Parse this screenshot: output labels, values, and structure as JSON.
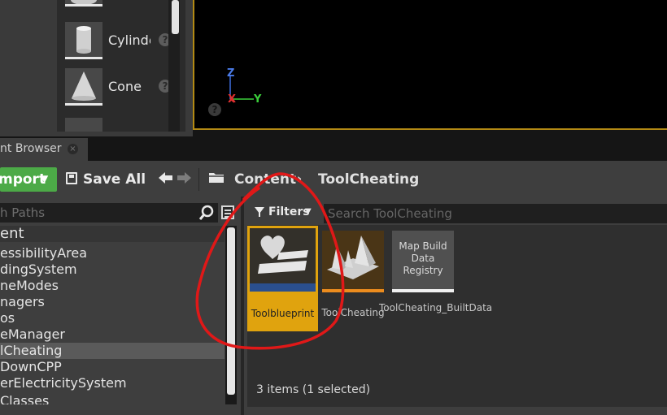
{
  "place_actors": {
    "items": [
      {
        "label": "Cylinder",
        "icon": "cylinder-icon"
      },
      {
        "label": "Cone",
        "icon": "cone-icon"
      }
    ],
    "help_glyph": "?"
  },
  "viewport": {
    "axis_z": "Z",
    "axis_x": "X",
    "axis_y": "Y",
    "help_glyph": "?"
  },
  "tab": {
    "label": "nt Browser",
    "close_glyph": "×"
  },
  "toolbar": {
    "import_label": "mport",
    "import_caret": "▼",
    "save_all_label": "Save All",
    "back_glyph": "🡄",
    "forward_glyph": "🡆"
  },
  "breadcrumb": {
    "root": "Content",
    "separator": "›",
    "current": "ToolCheating"
  },
  "sources": {
    "search_placeholder": "h Paths",
    "tree": [
      {
        "label": "ent",
        "selected": false,
        "root": true
      },
      {
        "label": "essibilityArea",
        "selected": false
      },
      {
        "label": "dingSystem",
        "selected": false
      },
      {
        "label": "neModes",
        "selected": false
      },
      {
        "label": "nagers",
        "selected": false
      },
      {
        "label": "os",
        "selected": false
      },
      {
        "label": "eManager",
        "selected": false
      },
      {
        "label": "lCheating",
        "selected": true
      },
      {
        "label": "DownCPP",
        "selected": false
      },
      {
        "label": "erElectricitySystem",
        "selected": false
      },
      {
        "label": "Classes",
        "selected": false
      }
    ]
  },
  "assets": {
    "filters_label": "Filters",
    "filters_caret": "▼",
    "search_placeholder": "Search ToolCheating",
    "items": [
      {
        "label": "Toolblueprint",
        "selected": true,
        "accent": "#e0a30e"
      },
      {
        "label": "ToolCheating",
        "selected": false,
        "accent": "#ec8c1e"
      },
      {
        "label": "ToolCheating_BuiltData",
        "thumb_text": "Map Build Data Registry",
        "selected": false,
        "accent": "#f0f0f0"
      }
    ],
    "status": "3 items (1 selected)"
  },
  "colors": {
    "accent_green": "#4caa47",
    "selection_yellow": "#e0a30e",
    "annotation_red": "#e01818",
    "viewport_border": "#b38a14"
  }
}
